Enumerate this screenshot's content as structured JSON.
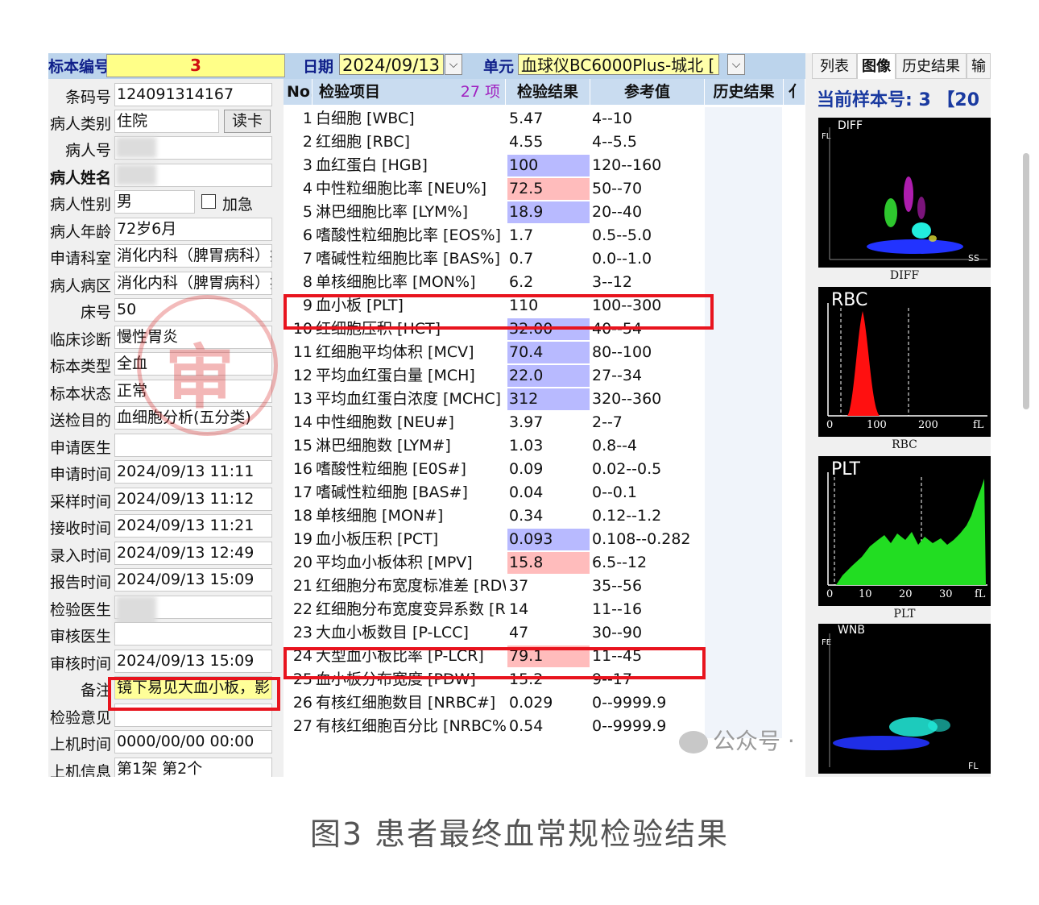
{
  "header": {
    "sample_no_label": "标本编号",
    "sample_no": "3",
    "date_label": "日期",
    "date": "2024/09/13",
    "unit_label": "单元",
    "unit": "血球仪BC6000Plus-城北 ["
  },
  "patient_fields": {
    "barcode": {
      "label": "条码号",
      "value": "124091314167"
    },
    "patient_type": {
      "label": "病人类别",
      "value": "住院",
      "button": "读卡"
    },
    "patient_no": {
      "label": "病人号",
      "value": ""
    },
    "patient_name": {
      "label": "病人姓名",
      "value": ""
    },
    "sex": {
      "label": "病人性别",
      "value": "男",
      "urgent_label": "加急"
    },
    "age": {
      "label": "病人年龄",
      "value": "72岁6月"
    },
    "dept": {
      "label": "申请科室",
      "value": "消化内科（脾胃病科）病"
    },
    "ward": {
      "label": "病人病区",
      "value": "消化内科（脾胃病科）病"
    },
    "bed": {
      "label": "床号",
      "value": "50"
    },
    "diagnosis": {
      "label": "临床诊断",
      "value": "慢性胃炎"
    },
    "specimen_type": {
      "label": "标本类型",
      "value": "全血"
    },
    "specimen_status": {
      "label": "标本状态",
      "value": "正常"
    },
    "purpose": {
      "label": "送检目的",
      "value": "血细胞分析(五分类)"
    },
    "doctor": {
      "label": "申请医生",
      "value": ""
    },
    "apply_time": {
      "label": "申请时间",
      "value": "2024/09/13 11:11"
    },
    "sample_time": {
      "label": "采样时间",
      "value": "2024/09/13 11:12"
    },
    "receive_time": {
      "label": "接收时间",
      "value": "2024/09/13 11:21"
    },
    "entry_time": {
      "label": "录入时间",
      "value": "2024/09/13 12:49"
    },
    "report_time": {
      "label": "报告时间",
      "value": "2024/09/13 15:09"
    },
    "tester": {
      "label": "检验医生",
      "value": ""
    },
    "reviewer": {
      "label": "审核医生",
      "value": ""
    },
    "review_time": {
      "label": "审核时间",
      "value": "2024/09/13 15:09"
    },
    "remark": {
      "label": "备注",
      "value": "镜下易见大血小板，影"
    },
    "opinion": {
      "label": "检验意见",
      "value": ""
    },
    "machine_time": {
      "label": "上机时间",
      "value": "0000/00/00 00:00"
    },
    "machine_info": {
      "label": "上机信息",
      "value": "第1架 第2个"
    }
  },
  "stamp_char": "审",
  "table": {
    "headers": {
      "no": "No.",
      "item": "检验项目",
      "count": "27 项",
      "result": "检验结果",
      "ref": "参考值",
      "history": "历史结果",
      "extra": "亻"
    },
    "rows": [
      {
        "no": "1",
        "item": "白细胞 [WBC]",
        "result": "5.47",
        "ref": "4--10",
        "flag": "normal"
      },
      {
        "no": "2",
        "item": "红细胞 [RBC]",
        "result": "4.55",
        "ref": "4--5.5",
        "flag": "normal"
      },
      {
        "no": "3",
        "item": "血红蛋白 [HGB]",
        "result": "100",
        "ref": "120--160",
        "flag": "low"
      },
      {
        "no": "4",
        "item": "中性粒细胞比率 [NEU%]",
        "result": "72.5",
        "ref": "50--70",
        "flag": "high"
      },
      {
        "no": "5",
        "item": "淋巴细胞比率 [LYM%]",
        "result": "18.9",
        "ref": "20--40",
        "flag": "low"
      },
      {
        "no": "6",
        "item": "嗜酸性粒细胞比率 [EOS%]",
        "result": "1.7",
        "ref": "0.5--5.0",
        "flag": "normal"
      },
      {
        "no": "7",
        "item": "嗜碱性粒细胞比率 [BAS%]",
        "result": "0.7",
        "ref": "0.0--1.0",
        "flag": "normal"
      },
      {
        "no": "8",
        "item": "单核细胞比率 [MON%]",
        "result": "6.2",
        "ref": "3--12",
        "flag": "normal"
      },
      {
        "no": "9",
        "item": "血小板 [PLT]",
        "result": "110",
        "ref": "100--300",
        "flag": "normal"
      },
      {
        "no": "10",
        "item": "红细胞压积 [HCT]",
        "result": "32.00",
        "ref": "40--54",
        "flag": "low"
      },
      {
        "no": "11",
        "item": "红细胞平均体积 [MCV]",
        "result": "70.4",
        "ref": "80--100",
        "flag": "low"
      },
      {
        "no": "12",
        "item": "平均血红蛋白量 [MCH]",
        "result": "22.0",
        "ref": "27--34",
        "flag": "low"
      },
      {
        "no": "13",
        "item": "平均血红蛋白浓度 [MCHC]",
        "result": "312",
        "ref": "320--360",
        "flag": "low"
      },
      {
        "no": "14",
        "item": "中性细胞数 [NEU#]",
        "result": "3.97",
        "ref": "2--7",
        "flag": "normal"
      },
      {
        "no": "15",
        "item": "淋巴细胞数 [LYM#]",
        "result": "1.03",
        "ref": "0.8--4",
        "flag": "normal"
      },
      {
        "no": "16",
        "item": "嗜酸性粒细胞 [E0S#]",
        "result": "0.09",
        "ref": "0.02--0.5",
        "flag": "normal"
      },
      {
        "no": "17",
        "item": "嗜碱性粒细胞 [BAS#]",
        "result": "0.04",
        "ref": "0--0.1",
        "flag": "normal"
      },
      {
        "no": "18",
        "item": "单核细胞 [MON#]",
        "result": "0.34",
        "ref": "0.12--1.2",
        "flag": "normal"
      },
      {
        "no": "19",
        "item": "血小板压积 [PCT]",
        "result": "0.093",
        "ref": "0.108--0.282",
        "flag": "low"
      },
      {
        "no": "20",
        "item": "平均血小板体积 [MPV]",
        "result": "15.8",
        "ref": "6.5--12",
        "flag": "high"
      },
      {
        "no": "21",
        "item": "红细胞分布宽度标准差 [RDW",
        "result": "37",
        "ref": "35--56",
        "flag": "normal"
      },
      {
        "no": "22",
        "item": "红细胞分布宽度变异系数 [RI",
        "result": "14",
        "ref": "11--16",
        "flag": "normal"
      },
      {
        "no": "23",
        "item": "大血小板数目 [P-LCC]",
        "result": "47",
        "ref": "30--90",
        "flag": "normal"
      },
      {
        "no": "24",
        "item": "大型血小板比率 [P-LCR]",
        "result": "79.1",
        "ref": "11--45",
        "flag": "high"
      },
      {
        "no": "25",
        "item": "血小板分布宽度 [PDW]",
        "result": "15.2",
        "ref": "9--17",
        "flag": "normal"
      },
      {
        "no": "26",
        "item": "有核红细胞数目 [NRBC#]",
        "result": "0.029",
        "ref": "0--9999.9",
        "flag": "normal"
      },
      {
        "no": "27",
        "item": "有核红细胞百分比 [NRBC%]",
        "result": "0.54",
        "ref": "0--9999.9",
        "flag": "normal"
      }
    ]
  },
  "right_panel": {
    "tabs": [
      "列表",
      "图像",
      "历史结果",
      "输"
    ],
    "active_tab": "图像",
    "current_sample": "当前样本号: 3 【20",
    "graphs": {
      "diff": {
        "title": "DIFF",
        "y_axis": "FL",
        "x_axis": "SS",
        "caption": "DIFF"
      },
      "rbc": {
        "title": "RBC",
        "ticks": [
          "0",
          "100",
          "200",
          "fL"
        ],
        "caption": "RBC"
      },
      "plt": {
        "title": "PLT",
        "ticks": [
          "0",
          "10",
          "20",
          "30",
          "fL"
        ],
        "caption": "PLT"
      },
      "wnb": {
        "title": "WNB",
        "y_axis": "FE",
        "x_axis": "FL"
      }
    }
  },
  "colors": {
    "low": "#b8baff",
    "high": "#ffbcbc",
    "highlight_box": "#e8141e",
    "header_blue": "#10208a"
  },
  "watermark": "公众号 ·",
  "caption": "图3 患者最终血常规检验结果"
}
